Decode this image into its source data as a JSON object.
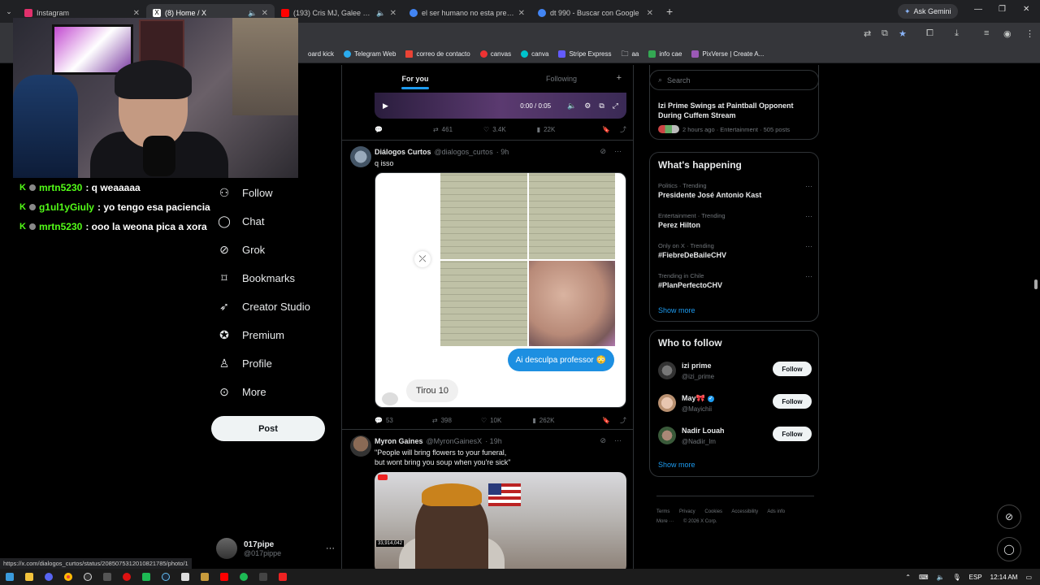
{
  "browser": {
    "tabs": [
      {
        "title": "Instagram",
        "color": "#e1306c",
        "active": false
      },
      {
        "title": "(8) Home / X",
        "color": "#ffffff",
        "active": true
      },
      {
        "title": "(193) Cris MJ, Galee Galee",
        "color": "#ff0000",
        "active": false
      },
      {
        "title": "el ser humano no esta prepara",
        "color": "#4285f4",
        "active": false
      },
      {
        "title": "dt 990 - Buscar con Google",
        "color": "#4285f4",
        "active": false
      }
    ],
    "ask_gemini": "Ask Gemini",
    "bookmarks": [
      {
        "label": "oard kick",
        "color": "#53fc18"
      },
      {
        "label": "Telegram Web",
        "color": "#2aabee"
      },
      {
        "label": "correo de contacto",
        "color": "#ea4335"
      },
      {
        "label": "canvas",
        "color": "#e33"
      },
      {
        "label": "canva",
        "color": "#00c4cc"
      },
      {
        "label": "Stripe Express",
        "color": "#635bff"
      },
      {
        "label": "aa",
        "color": "#cccccc"
      },
      {
        "label": "info cae",
        "color": "#34a853"
      },
      {
        "label": "PixVerse | Create A...",
        "color": "#9b59b6"
      }
    ],
    "status_url": "https://x.com/dialogos_curtos/status/2085075312010821785/photo/1"
  },
  "stream_chat": [
    {
      "user": "mrtn5230",
      "message": ": q weaaaaa",
      "user_color": "#53fc18"
    },
    {
      "user": "g1ul1yGiuly",
      "message": ": yo tengo esa paciencia",
      "user_color": "#53fc18"
    },
    {
      "user": "mrtn5230",
      "message": ": ooo la weona pica a xora",
      "user_color": "#53fc18"
    }
  ],
  "nav": {
    "items": [
      {
        "label": "Follow",
        "icon": "person-plus-icon"
      },
      {
        "label": "Chat",
        "icon": "chat-bubble-icon"
      },
      {
        "label": "Grok",
        "icon": "grok-icon"
      },
      {
        "label": "Bookmarks",
        "icon": "bookmark-icon"
      },
      {
        "label": "Creator Studio",
        "icon": "rocket-icon"
      },
      {
        "label": "Premium",
        "icon": "verified-badge-icon"
      },
      {
        "label": "Profile",
        "icon": "person-icon"
      },
      {
        "label": "More",
        "icon": "more-circle-icon"
      }
    ],
    "post_label": "Post",
    "account_name": "017pipe",
    "account_handle": "@017pippe"
  },
  "timeline": {
    "tabs": [
      "For you",
      "Following"
    ],
    "video": {
      "time": "0:00 / 0:05"
    },
    "prev_actions": {
      "replies": "",
      "reposts": "461",
      "likes": "3.4K",
      "views": "22K"
    },
    "tweets": [
      {
        "name": "Diálogos Curtos",
        "handle": "@dialogos_curtos",
        "time": "· 9h",
        "text": "q isso",
        "bubble_blue": "Ai desculpa professor 😳",
        "bubble_grey": "Tirou 10",
        "replies": "53",
        "reposts": "398",
        "likes": "10K",
        "views": "262K"
      },
      {
        "name": "Myron Gaines",
        "handle": "@MyronGainesX",
        "time": "· 19h",
        "text": "\"People will bring flowers to your funeral,\nbut wont bring you soup when you're  sick\"",
        "overlay_count": "33,914,042"
      }
    ]
  },
  "sidebar": {
    "search_placeholder": "Search",
    "news": {
      "title": "Izi Prime Swings at Paintball Opponent During Cuffem Stream",
      "meta": "2 hours ago · Entertainment · 505 posts"
    },
    "happening_title": "What's happening",
    "trends": [
      {
        "category": "Politics · Trending",
        "name": "Presidente José Antonio Kast"
      },
      {
        "category": "Entertainment · Trending",
        "name": "Perez Hilton"
      },
      {
        "category": "Only on X · Trending",
        "name": "#FiebreDeBaileCHV"
      },
      {
        "category": "Trending in Chile",
        "name": "#PlanPerfectoCHV"
      }
    ],
    "show_more": "Show more",
    "who_title": "Who to follow",
    "who": [
      {
        "name": "izi prime",
        "handle": "@izi_prime",
        "verified": false
      },
      {
        "name": "May🎀",
        "handle": "@Mayichii",
        "verified": true
      },
      {
        "name": "Nadir Louah",
        "handle": "@Nadiir_lm",
        "verified": false
      }
    ],
    "follow_label": "Follow",
    "footer": [
      "Terms",
      "Privacy",
      "Cookies",
      "Accessibility",
      "Ads info",
      "More ···",
      "© 2026 X Corp."
    ]
  },
  "taskbar": {
    "lang": "ESP",
    "time": "12:14 AM"
  }
}
